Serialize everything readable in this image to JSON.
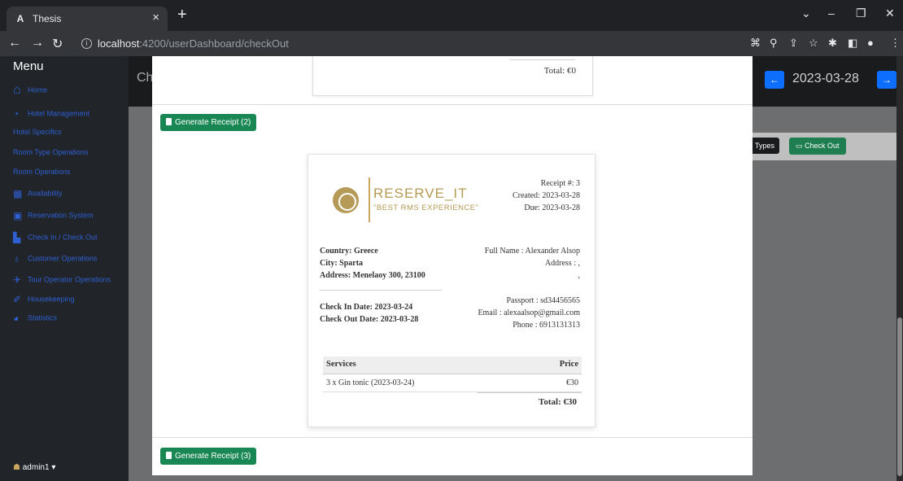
{
  "browser": {
    "tab_title": "Thesis",
    "tab_favicon": "A",
    "tab_close": "×",
    "new_tab": "+",
    "url_host": "localhost",
    "url_path": ":4200/userDashboard/checkOut"
  },
  "sidebar": {
    "title": "Menu",
    "items": [
      {
        "label": "Home",
        "icon": "home-icon"
      },
      {
        "label": "Hotel Management",
        "icon": "dashboard-icon"
      },
      {
        "label": "Hotel Specifics",
        "icon": ""
      },
      {
        "label": "Room Type Operations",
        "icon": ""
      },
      {
        "label": "Room Operations",
        "icon": ""
      },
      {
        "label": "Availability",
        "icon": "table-icon"
      },
      {
        "label": "Reservation System",
        "icon": "calendar-icon"
      },
      {
        "label": "Check In / Check Out",
        "icon": "checkin-icon"
      },
      {
        "label": "Customer Operations",
        "icon": "users-icon"
      },
      {
        "label": "Tour Operator Operations",
        "icon": "plane-icon"
      },
      {
        "label": "Housekeeping",
        "icon": "broom-icon"
      },
      {
        "label": "Statistics",
        "icon": "chart-icon"
      }
    ],
    "user": "admin1"
  },
  "header": {
    "title_fragment": "Ch",
    "date": "2023-03-28",
    "types_label": "Types",
    "check_out_label": "Check Out"
  },
  "modal": {
    "previous_total": "Total: €0",
    "buttons": [
      "Generate Receipt (2)",
      "Generate Receipt (3)"
    ],
    "receipt": {
      "brand": "RESERVE_IT",
      "slogan": "\"BEST RMS EXPERIENCE\"",
      "receipt_no": "Receipt #: 3",
      "created": "Created: 2023-03-28",
      "due": "Due: 2023-03-28",
      "country": "Country: Greece",
      "city": "City: Sparta",
      "address": "Address: Menelaoy 300, 23100",
      "full_name": "Full Name : Alexander Alsop",
      "guest_address": "Address : ,",
      "guest_address_2": ",",
      "check_in": "Check In Date: 2023-03-24",
      "check_out": "Check Out Date: 2023-03-28",
      "passport": "Passport : sd34456565",
      "email": "Email : alexaalsop@gmail.com",
      "phone": "Phone : 6913131313",
      "services_header": "Services",
      "price_header": "Price",
      "services": [
        {
          "name": "3 x Gin tonic (2023-03-24)",
          "price": "€30"
        }
      ],
      "total": "Total: €30"
    }
  }
}
